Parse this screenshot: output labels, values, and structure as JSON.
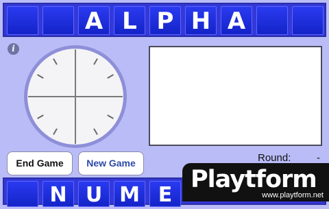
{
  "top_tiles": [
    "",
    "",
    "A",
    "L",
    "P",
    "H",
    "A",
    "",
    ""
  ],
  "bottom_tiles": [
    "",
    "N",
    "U",
    "M",
    "E"
  ],
  "info_icon_glyph": "i",
  "buttons": {
    "end_game": "End Game",
    "new_game": "New Game"
  },
  "round": {
    "label": "Round:",
    "value": "-"
  },
  "clock": {
    "face_color": "#f4f4f6",
    "rim_color": "#8e8fd8",
    "tick_color": "#6a6a6a",
    "hand_color": "#7a7a7a"
  },
  "watermark": {
    "logo_text": "Playtform",
    "url_text": "www.playtform.net"
  },
  "colors": {
    "background": "#b9bcf6",
    "tile_bar": "#3438d8",
    "tile": "#1f2fe0"
  }
}
